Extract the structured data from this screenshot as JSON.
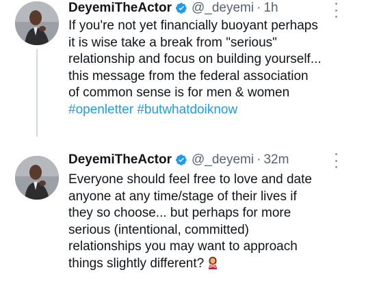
{
  "tweets": [
    {
      "author_name": "DeyemiTheActor",
      "handle": "@_deyemi",
      "separator": "·",
      "time": "1h",
      "lines": [
        "If you're not yet financially buoyant perhaps",
        "it is wise take a break from \"serious\"",
        "relationship and focus on building yourself...",
        "this message from the federal association",
        "of common sense is for men & women"
      ],
      "hashtags": [
        "#openletter",
        "#butwhatdoiknow"
      ]
    },
    {
      "author_name": "DeyemiTheActor",
      "handle": "@_deyemi",
      "separator": "·",
      "time": "32m",
      "lines": [
        "Everyone should feel free to love and date",
        "anyone at any time/stage of their lives if",
        "they so choose... but perhaps for more",
        "serious (intentional, committed)",
        "relationships you may want to approach",
        "things slightly different?"
      ],
      "trailing_emoji": "woman-gesturing-no-emoji"
    }
  ],
  "colors": {
    "text": "#0f1419",
    "secondary": "#536471",
    "link": "#1d9bf0",
    "verified": "#1d9bf0",
    "thread_line": "#cfd9de"
  }
}
